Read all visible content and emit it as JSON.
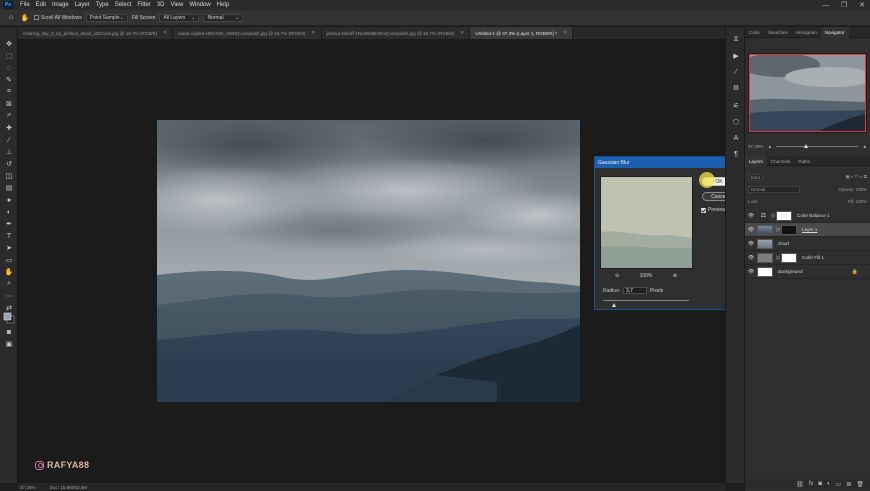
{
  "app": {
    "logo": "Ps"
  },
  "menu": [
    "File",
    "Edit",
    "Image",
    "Layer",
    "Type",
    "Select",
    "Filter",
    "3D",
    "View",
    "Window",
    "Help"
  ],
  "window_controls": {
    "minimize": "—",
    "maximize": "❐",
    "close": "✕"
  },
  "options_bar": {
    "scroll_all_label": "Scroll All Windows",
    "sample_value": "Point Sample",
    "fill_screen_label": "Fill Screen",
    "layers_value": "All Layers",
    "mode_value": "Normal"
  },
  "doc_tabs": [
    {
      "label": "clearing_sky_3_by_jerlinus_stock_d22cuxk.jpg @ 16,7% (RGB/8)",
      "active": false
    },
    {
      "label": "ioana-cajitea-HDd-NO_AMNQ-unsplash.jpg @ 16,7% (RGB/8)",
      "active": false
    },
    {
      "label": "joshua-sukoff-1NoW8dBoOoQ-unsplash.jpg @ 16,7% (RGB/8)",
      "active": false
    },
    {
      "label": "Untitled-1 @ 37,3% (Layer 1, RGB/8#) *",
      "active": true
    }
  ],
  "status": {
    "zoom": "37,26%",
    "doc": "Doc: 15,9M/63,4M"
  },
  "watermark": "RAFYA88",
  "dialog": {
    "title": "Gaussian Blur",
    "ok": "OK",
    "cancel": "Cancel",
    "preview_label": "Preview",
    "preview_checked": true,
    "zoom_out": "⊖",
    "zoom_in": "⊕",
    "zoom_value": "100%",
    "radius_label": "Radius:",
    "radius_value": "3,7",
    "radius_unit": "Pixels"
  },
  "panels": {
    "top_tabs": [
      {
        "label": "Color",
        "active": false
      },
      {
        "label": "Swatches",
        "active": false
      },
      {
        "label": "Histogram",
        "active": false
      },
      {
        "label": "Navigator",
        "active": true
      }
    ],
    "nav_zoom": "37,26%",
    "layer_tabs": [
      {
        "label": "Layers",
        "active": true
      },
      {
        "label": "Channels",
        "active": false
      },
      {
        "label": "Paths",
        "active": false
      }
    ],
    "kind_value": "Kind",
    "blend_value": "Normal",
    "opacity_label": "Opacity: 100%",
    "lock_label": "Lock:",
    "fill_label": "Fill: 100%",
    "layers": [
      {
        "name": "Color Balance 1",
        "type": "adjustment",
        "selected": false
      },
      {
        "name": "Layer 1",
        "type": "masked",
        "selected": true
      },
      {
        "name": "cloud",
        "type": "image",
        "selected": false
      },
      {
        "name": "Color Fill 1",
        "type": "fill",
        "selected": false
      },
      {
        "name": "Background",
        "type": "background",
        "selected": false
      }
    ]
  },
  "colors": {
    "accent": "#1c5fae",
    "nav_frame": "#e0393e",
    "cursor_highlight": "#f0e646"
  }
}
